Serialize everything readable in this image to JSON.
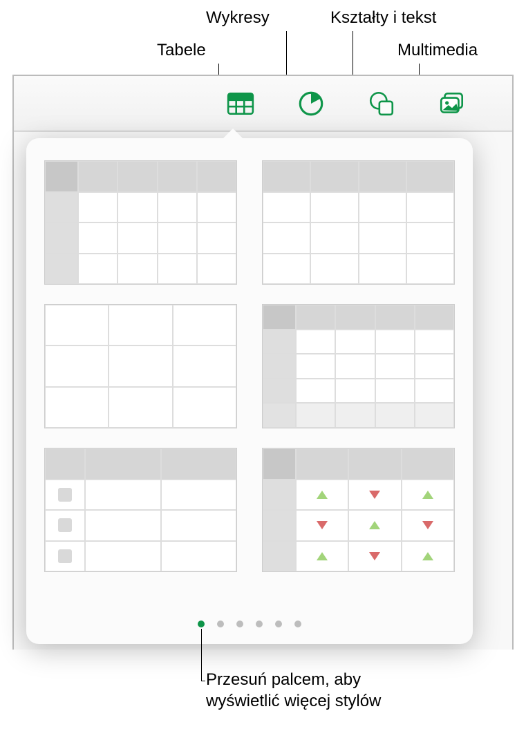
{
  "callouts": {
    "tables": "Tabele",
    "charts": "Wykresy",
    "shapes": "Kształty i tekst",
    "media": "Multimedia",
    "swipe": "Przesuń palcem, aby\nwyświetlić więcej stylów"
  },
  "toolbar": {
    "tables": "table-icon",
    "charts": "chart-icon",
    "shapes": "shapes-icon",
    "media": "media-icon"
  },
  "popover": {
    "pages_total": 6,
    "active_page": 1
  }
}
